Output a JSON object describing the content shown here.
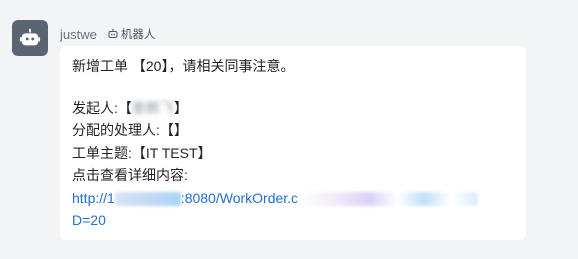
{
  "sender": {
    "name": "justwe",
    "tag": "机器人"
  },
  "message": {
    "line1": "新增工单 【20】，请相关同事注意。",
    "initiator_label": "发起人:【",
    "initiator_value": "娄鹏飞",
    "initiator_close": "】",
    "assignee": "分配的处理人:【】",
    "subject": "工单主题:【IT TEST】",
    "detail_prompt": "点击查看详细内容:",
    "link_start": "http://1",
    "link_mid": ":8080/WorkOrder.c",
    "link_end": "D=20"
  },
  "colors": {
    "avatar_bg": "#5b6472",
    "link": "#1f6fd1",
    "background": "#f3f4f6",
    "bubble": "#ffffff"
  },
  "icons": {
    "avatar": "robot-icon",
    "tag": "robot-outline-icon"
  }
}
